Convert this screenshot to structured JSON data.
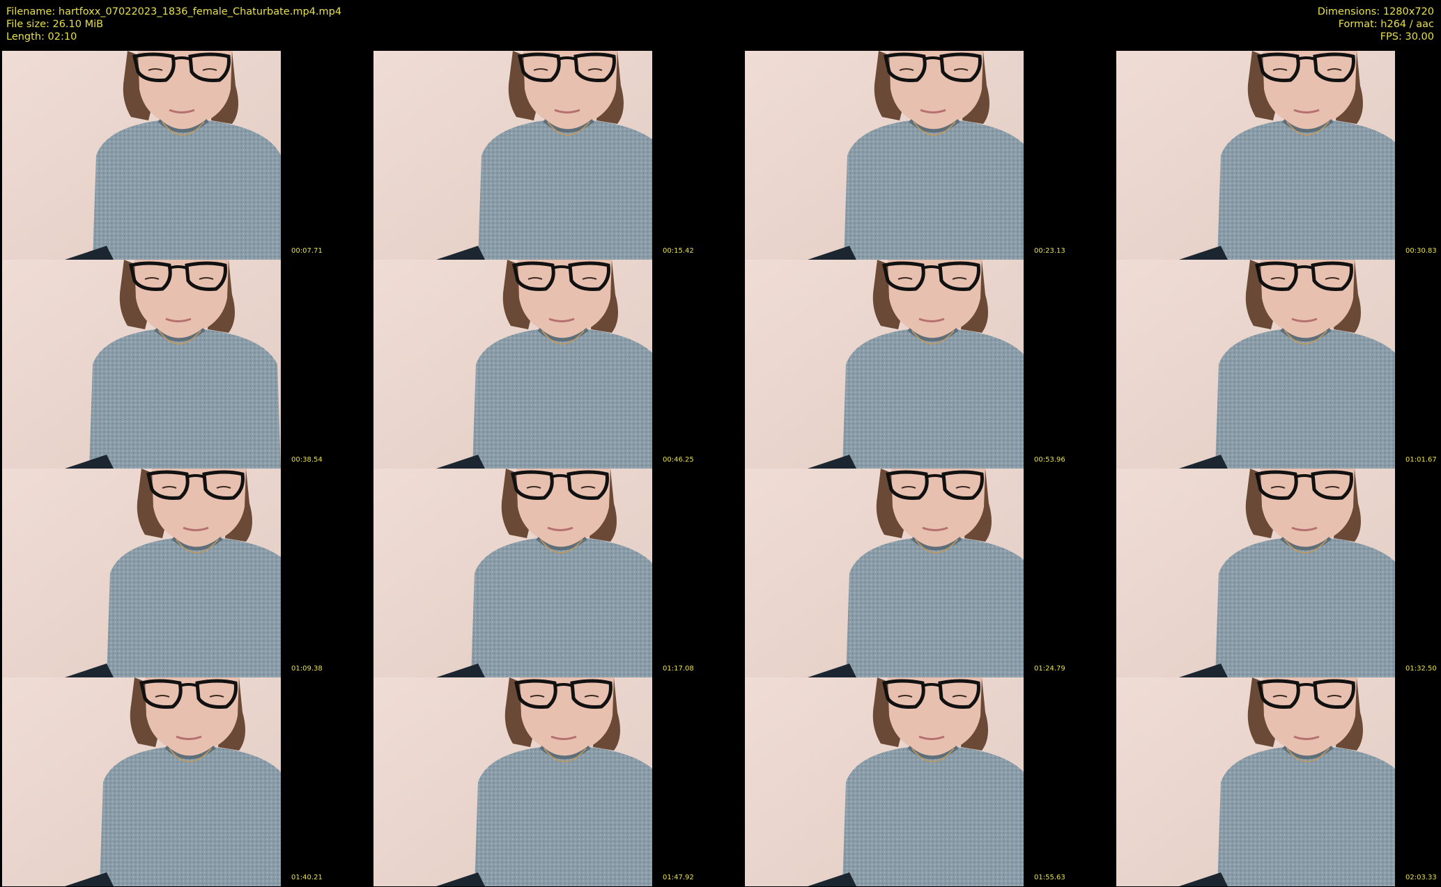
{
  "info": {
    "filename": "Filename: hartfoxx_07022023_1836_female_Chaturbate.mp4.mp4",
    "filesize": "File size: 26.10 MiB",
    "length": "Length: 02:10",
    "dimensions": "Dimensions: 1280x720",
    "format": "Format: h264 / aac",
    "fps": "FPS: 30.00"
  },
  "colors": {
    "text": "#e8e04a",
    "background": "#000000",
    "wall": "#ead7cf",
    "hair": "#6a4a36",
    "sweater": "#8a9ca8",
    "skin": "#e8c0b0"
  },
  "thumbnails": [
    {
      "time": "00:07.71"
    },
    {
      "time": "00:15.42"
    },
    {
      "time": "00:23.13"
    },
    {
      "time": "00:30.83"
    },
    {
      "time": "00:38.54"
    },
    {
      "time": "00:46.25"
    },
    {
      "time": "00:53.96"
    },
    {
      "time": "01:01.67"
    },
    {
      "time": "01:09.38"
    },
    {
      "time": "01:17.08"
    },
    {
      "time": "01:24.79"
    },
    {
      "time": "01:32.50"
    },
    {
      "time": "01:40.21"
    },
    {
      "time": "01:47.92"
    },
    {
      "time": "01:55.63"
    },
    {
      "time": "02:03.33"
    }
  ]
}
